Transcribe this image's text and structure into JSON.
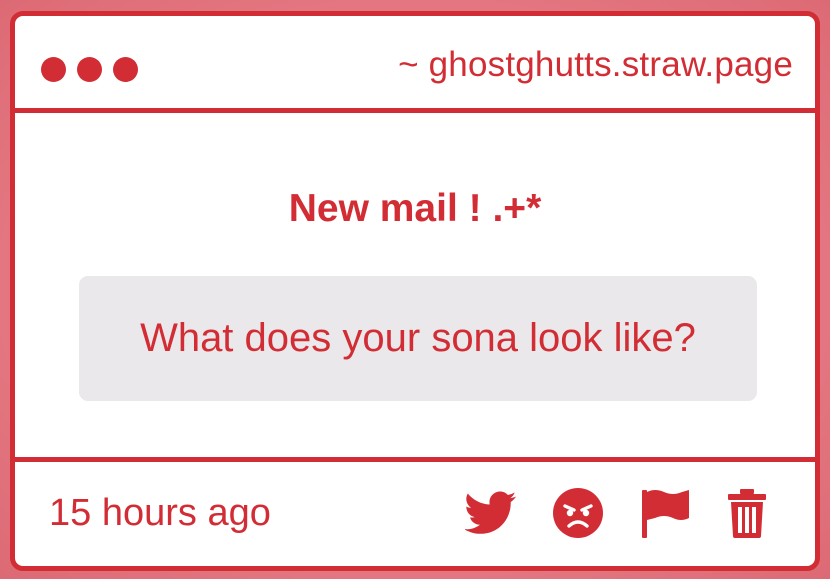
{
  "window": {
    "url": "~ ghostghutts.straw.page"
  },
  "message": {
    "heading": "New mail ! .+*",
    "question": "What does your sona look like?"
  },
  "footer": {
    "timestamp": "15 hours ago",
    "actions": [
      {
        "icon": "twitter-icon"
      },
      {
        "icon": "angry-face-icon"
      },
      {
        "icon": "flag-icon"
      },
      {
        "icon": "trash-icon"
      }
    ]
  },
  "colors": {
    "accent": "#d22d34",
    "question_background": "#eae8ea",
    "page_background": "#e37680"
  }
}
